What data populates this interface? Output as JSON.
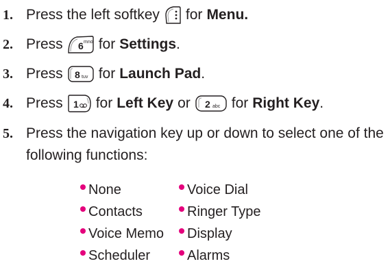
{
  "steps": [
    {
      "number": "1.",
      "before": "Press the left softkey",
      "key_icon": "left-softkey-icon",
      "after": "for",
      "bold": "Menu."
    },
    {
      "number": "2.",
      "before": "Press",
      "key_icon": "key-6-mno-icon",
      "key_digit": "6",
      "key_letters": "mno",
      "after": "for",
      "bold": "Settings",
      "end": "."
    },
    {
      "number": "3.",
      "before": "Press",
      "key_icon": "key-8-tuv-icon",
      "key_digit": "8",
      "key_letters": "tuv",
      "after": "for",
      "bold": "Launch Pad",
      "end": "."
    },
    {
      "number": "4.",
      "before": "Press",
      "key_icon": "key-1-voicemail-icon",
      "key_digit": "1",
      "after": "for",
      "bold": "Left Key",
      "middle": "or",
      "key2_icon": "key-2-abc-icon",
      "key2_digit": "2",
      "key2_letters": "abc",
      "after2": "for",
      "bold2": "Right Key",
      "end": "."
    },
    {
      "number": "5.",
      "line1": "Press the navigation key up or down to select one of the",
      "line2": "following functions:"
    }
  ],
  "functions_left": [
    "None",
    "Contacts",
    "Voice Memo",
    "Scheduler"
  ],
  "functions_right": [
    "Voice Dial",
    "Ringer Type",
    "Display",
    "Alarms"
  ],
  "colors": {
    "text": "#231f20",
    "bullet": "#e4007c"
  }
}
